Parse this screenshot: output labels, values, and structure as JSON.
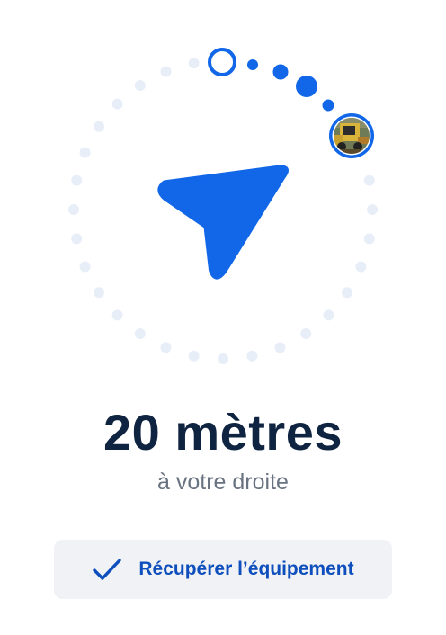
{
  "navigation": {
    "distance": "20 mètres",
    "direction": "à votre droite",
    "accent_color": "#1167e8",
    "track_color": "#e8eef8"
  },
  "target": {
    "icon": "skid-steer-loader-avatar"
  },
  "action": {
    "label": "Récupérer l’équipement",
    "icon": "checkmark-icon"
  }
}
